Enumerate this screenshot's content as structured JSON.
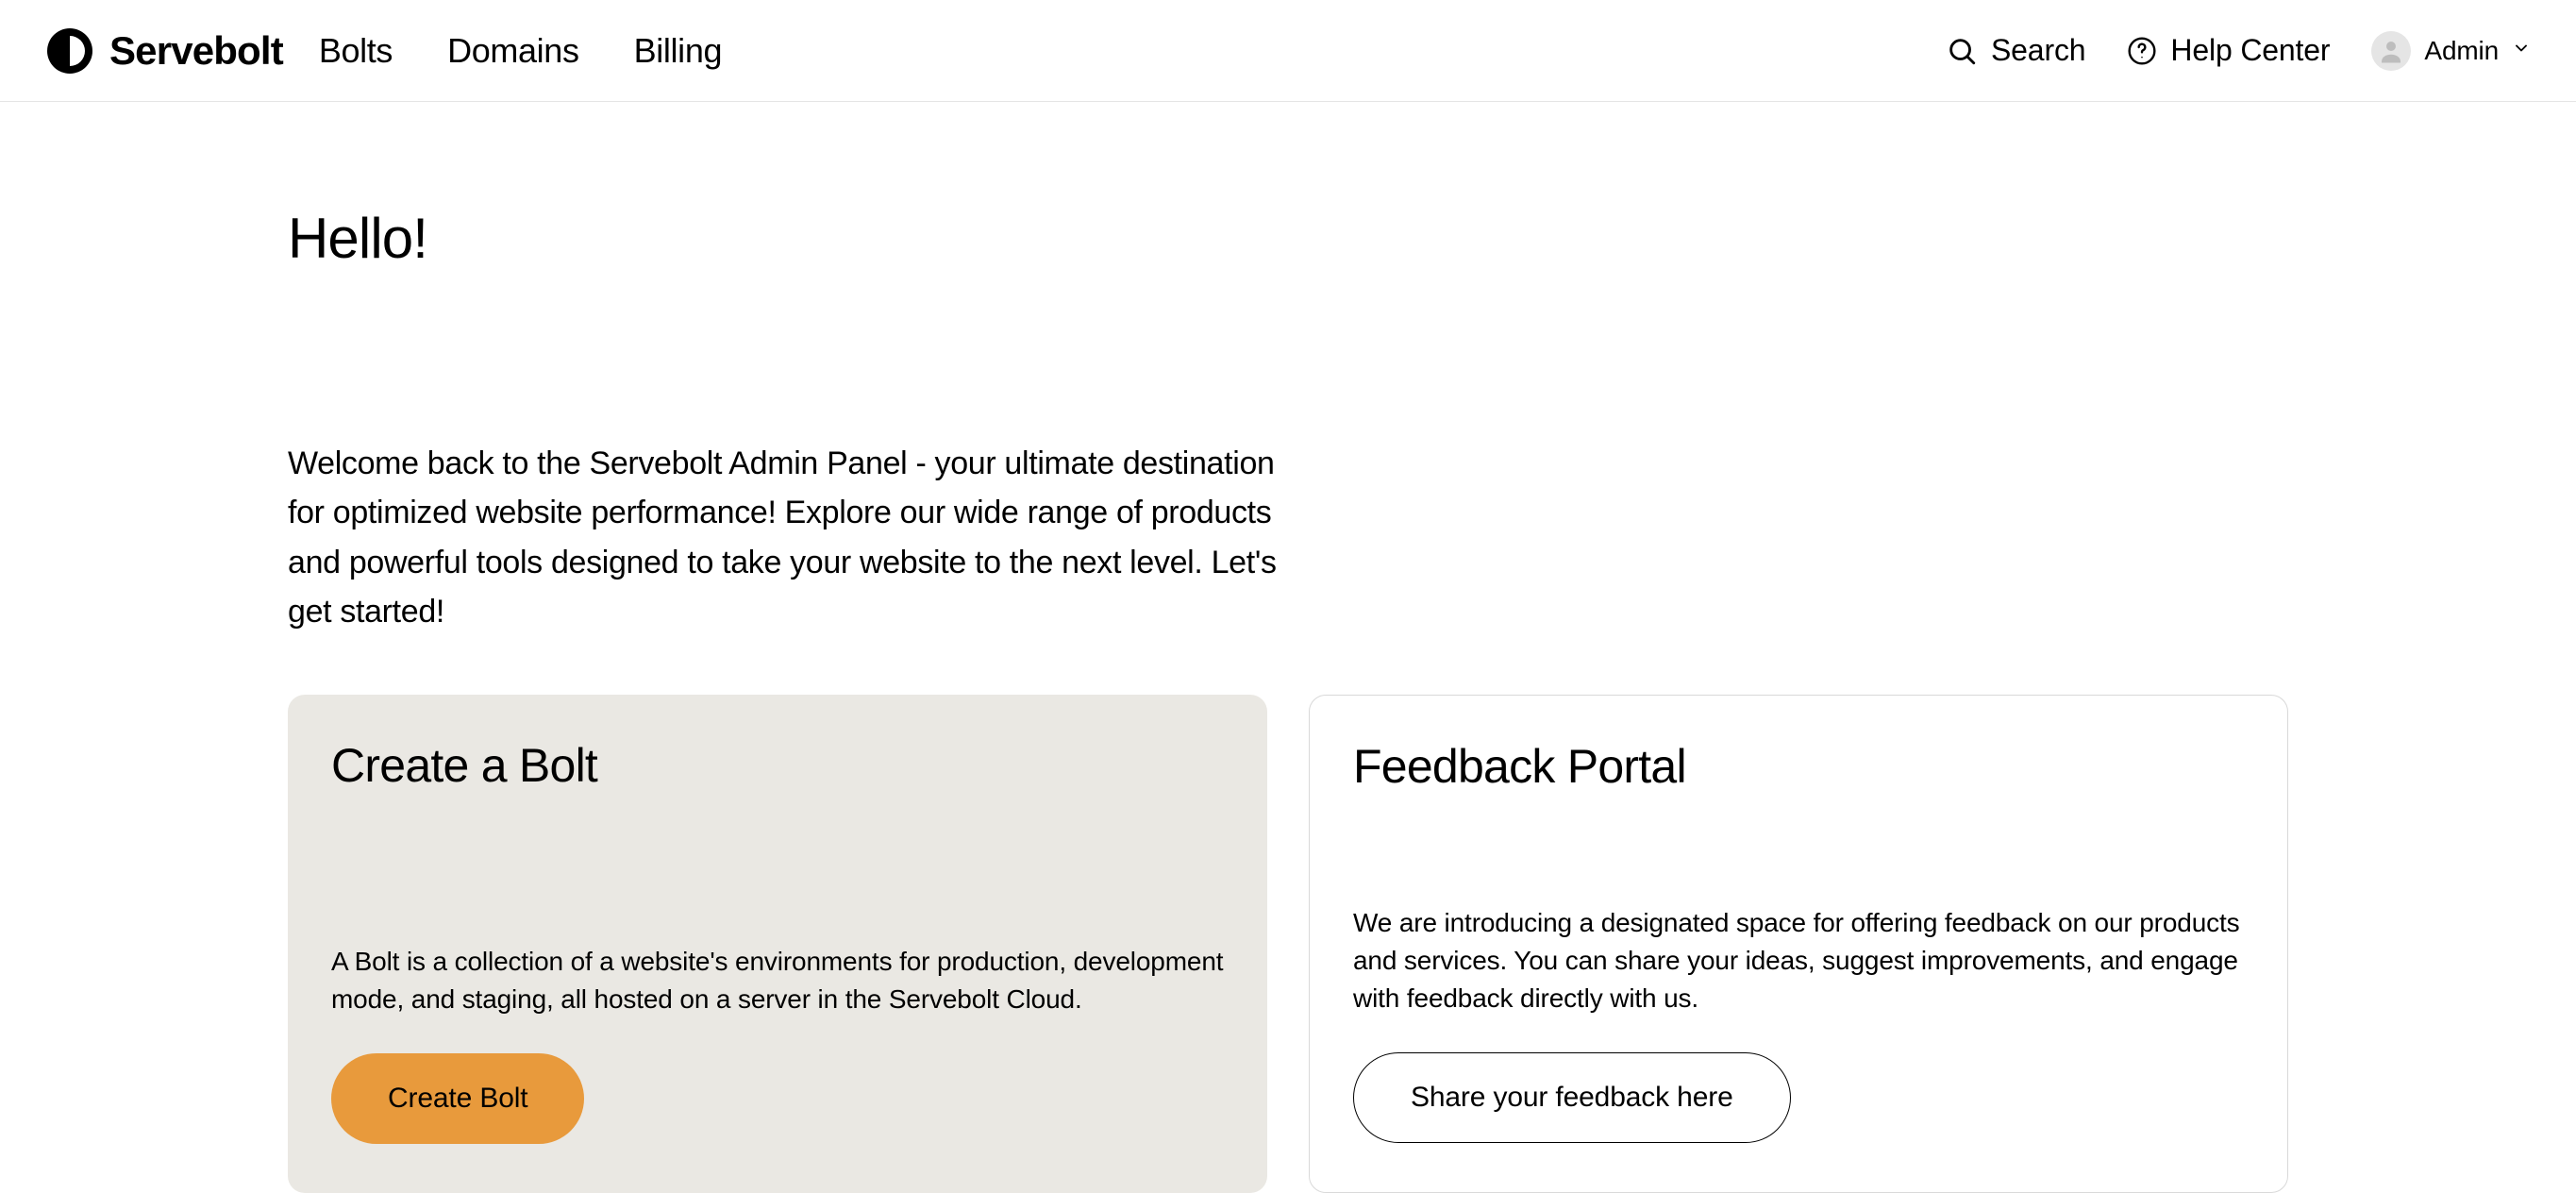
{
  "header": {
    "wordmark": "Servebolt",
    "nav": [
      {
        "label": "Bolts"
      },
      {
        "label": "Domains"
      },
      {
        "label": "Billing"
      }
    ],
    "search_label": "Search",
    "help_label": "Help Center",
    "user_name": "Admin"
  },
  "page": {
    "title": "Hello!",
    "welcome": "Welcome back to the Servebolt Admin Panel - your ultimate destination for optimized website performance! Explore our wide range of products and powerful tools designed to take your website to the next level. Let's get started!"
  },
  "cards": {
    "create_bolt": {
      "title": "Create a Bolt",
      "body": "A Bolt is a collection of a website's environments for production, development mode, and staging, all hosted on a server in the Servebolt Cloud.",
      "button": "Create Bolt"
    },
    "feedback": {
      "title": "Feedback Portal",
      "body": "We are introducing a designated space for offering feedback on our products and services. You can share your ideas, suggest improvements, and engage with feedback directly with us.",
      "button": "Share your feedback here"
    }
  }
}
